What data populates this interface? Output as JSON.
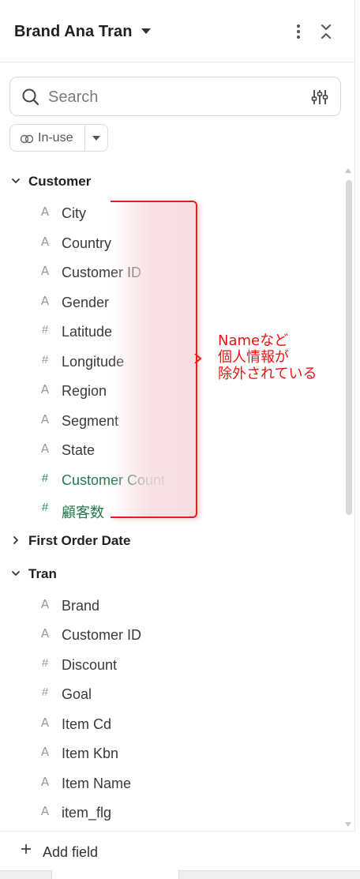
{
  "header": {
    "title": "Brand Ana Tran"
  },
  "search": {
    "placeholder": "Search"
  },
  "filter": {
    "selected": "In-use"
  },
  "groups": [
    {
      "label": "Customer",
      "expanded": true,
      "fields": [
        {
          "label": "City",
          "type": "text"
        },
        {
          "label": "Country",
          "type": "text"
        },
        {
          "label": "Customer ID",
          "type": "text"
        },
        {
          "label": "Gender",
          "type": "text"
        },
        {
          "label": "Latitude",
          "type": "number"
        },
        {
          "label": "Longitude",
          "type": "number"
        },
        {
          "label": "Region",
          "type": "text"
        },
        {
          "label": "Segment",
          "type": "text"
        },
        {
          "label": "State",
          "type": "text"
        },
        {
          "label": "Customer Count",
          "type": "measure"
        },
        {
          "label": "顧客数",
          "type": "measure"
        }
      ]
    },
    {
      "label": "First Order Date",
      "expanded": false,
      "fields": []
    },
    {
      "label": "Tran",
      "expanded": true,
      "fields": [
        {
          "label": "Brand",
          "type": "text"
        },
        {
          "label": "Customer ID",
          "type": "text"
        },
        {
          "label": "Discount",
          "type": "number"
        },
        {
          "label": "Goal",
          "type": "number"
        },
        {
          "label": "Item Cd",
          "type": "text"
        },
        {
          "label": "Item Kbn",
          "type": "text"
        },
        {
          "label": "Item Name",
          "type": "text"
        },
        {
          "label": "item_flg",
          "type": "text"
        }
      ]
    }
  ],
  "annotation": {
    "lines": [
      "Nameなど",
      "個人情報が",
      "除外されている"
    ],
    "color": "#ef1212"
  },
  "footer": {
    "add_label": "Add field"
  },
  "colors": {
    "measure": "#237a4b",
    "annotation": "#e02020"
  }
}
